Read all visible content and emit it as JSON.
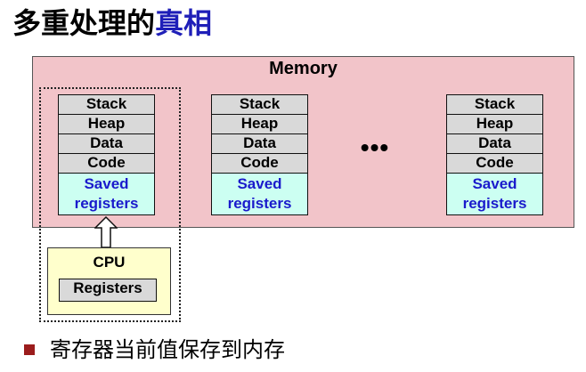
{
  "title": {
    "part1": "多重处理的",
    "part2": "真相"
  },
  "memory": {
    "label": "Memory"
  },
  "stack_cells": [
    "Stack",
    "Heap",
    "Data",
    "Code"
  ],
  "saved": {
    "line1": "Saved",
    "line2": "registers"
  },
  "ellipsis": "•••",
  "cpu": {
    "label": "CPU",
    "registers": "Registers"
  },
  "bullet": {
    "text": "寄存器当前值保存到内存"
  },
  "colors": {
    "memory_bg": "#f2c4c9",
    "cell_bg": "#d9d9d9",
    "saved_bg": "#ccfff2",
    "saved_text": "#1a1acc",
    "cpu_bg": "#ffffcc",
    "title_highlight": "#1f1fb8",
    "bullet": "#9b1c1c"
  }
}
